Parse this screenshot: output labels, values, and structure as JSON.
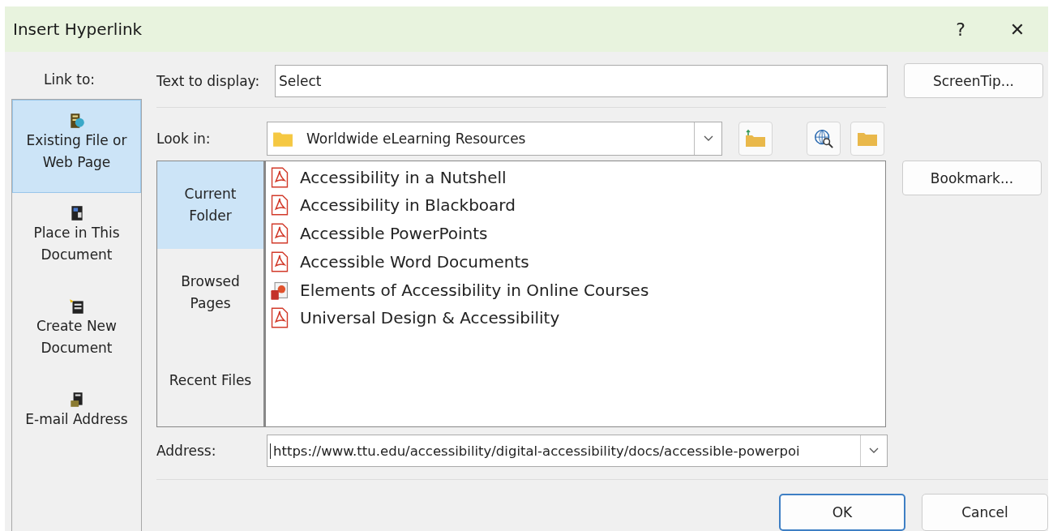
{
  "window": {
    "title": "Insert Hyperlink",
    "help": "?",
    "close": "✕"
  },
  "link_to": {
    "label": "Link to:",
    "items": [
      {
        "kind": "file",
        "label": "Existing File or Web Page",
        "selected": true
      },
      {
        "kind": "place",
        "label": "Place in This Document",
        "selected": false
      },
      {
        "kind": "new",
        "label": "Create New Document",
        "selected": false
      },
      {
        "kind": "email",
        "label": "E-mail Address",
        "selected": false
      }
    ]
  },
  "text_to_display": {
    "label": "Text to display:",
    "value": "Select"
  },
  "look_in": {
    "label": "Look in:",
    "value": "Worldwide eLearning Resources"
  },
  "places": [
    {
      "label": "Current Folder",
      "selected": true
    },
    {
      "label": "Browsed Pages",
      "selected": false
    },
    {
      "label": "Recent Files",
      "selected": false
    }
  ],
  "files": [
    {
      "kind": "pdf",
      "name": "Accessibility in a Nutshell"
    },
    {
      "kind": "pdf",
      "name": "Accessibility in Blackboard"
    },
    {
      "kind": "pdf",
      "name": "Accessible PowerPoints"
    },
    {
      "kind": "pdf",
      "name": "Accessible Word Documents"
    },
    {
      "kind": "pptx",
      "name": "Elements of Accessibility in Online Courses"
    },
    {
      "kind": "pdf",
      "name": "Universal Design & Accessibility"
    }
  ],
  "address": {
    "label": "Address:",
    "value": "https://www.ttu.edu/accessibility/digital-accessibility/docs/accessible-powerpoi"
  },
  "buttons": {
    "screentip": "ScreenTip...",
    "bookmark": "Bookmark...",
    "ok": "OK",
    "cancel": "Cancel"
  }
}
